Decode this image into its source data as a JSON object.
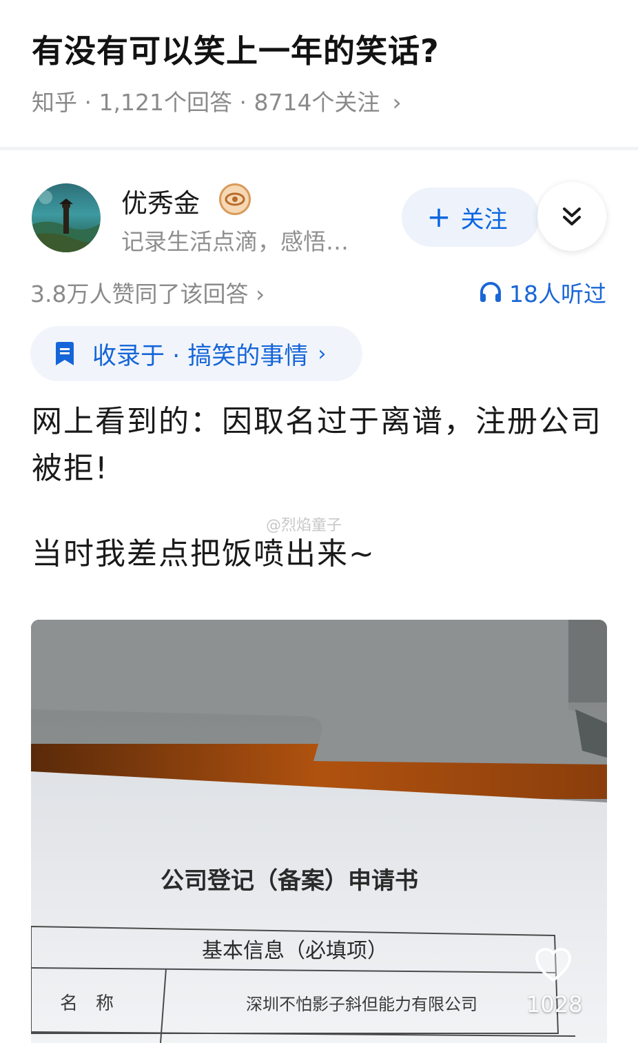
{
  "question": {
    "title": "有没有可以笑上一年的笑话?",
    "source": "知乎",
    "answers": "1,121个回答",
    "followers": "8714个关注",
    "separator": " · "
  },
  "author": {
    "name": "优秀金",
    "bio": "记录生活点滴，感悟…",
    "follow_label": "关注"
  },
  "stats": {
    "votes": "3.8万人赞同了该回答",
    "listened": "18人听过"
  },
  "collection": {
    "label": "收录于 · 搞笑的事情"
  },
  "content": {
    "line1": "网上看到的：因取名过于离谱，注册公司被拒!",
    "line2": "当时我差点把饭喷出来~",
    "watermark": "@烈焰童子"
  },
  "document": {
    "heading": "公司登记（备案）申请书",
    "section": "基本信息（必填项）",
    "field_label": "名　称",
    "field_value": "深圳不怕影子斜但能力有限公司"
  },
  "likes": {
    "count": "1028"
  },
  "colors": {
    "accent": "#0a66e0",
    "muted": "#8a8a8a"
  }
}
